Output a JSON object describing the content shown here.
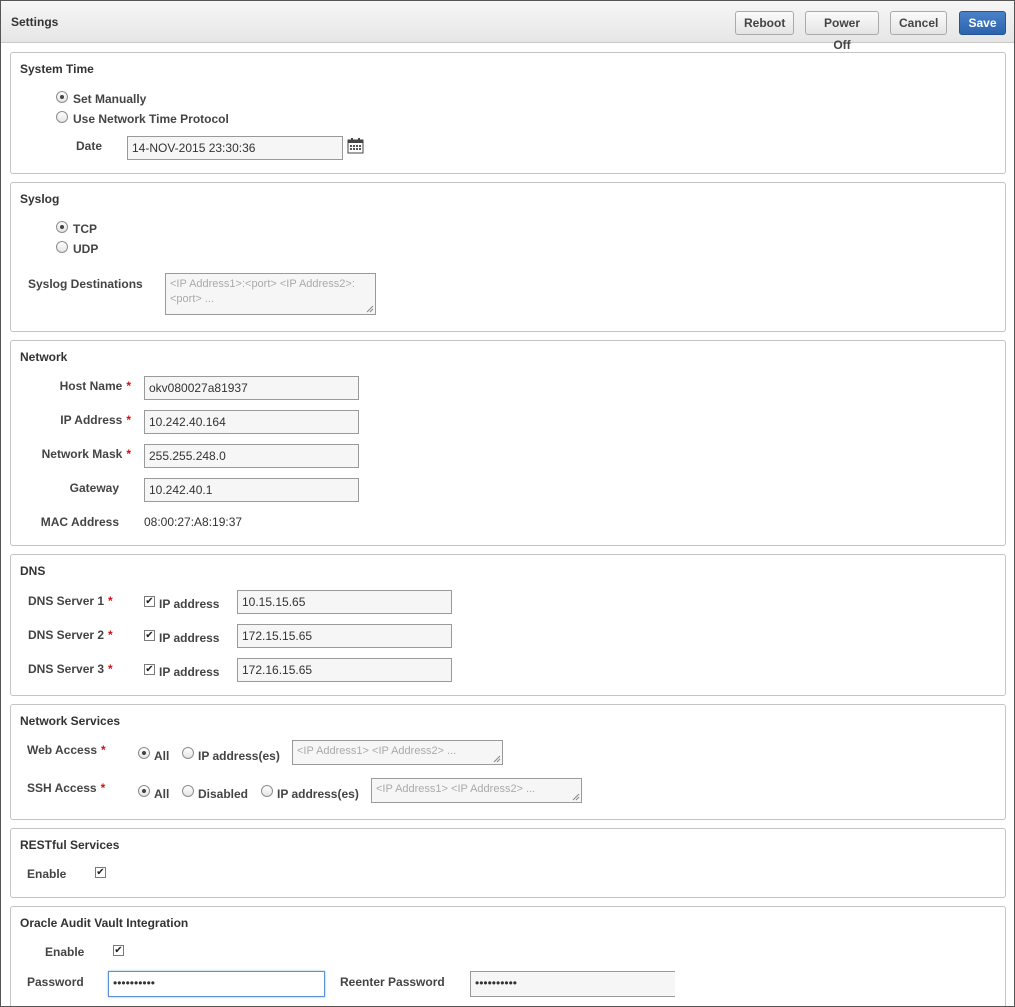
{
  "header": {
    "title": "Settings",
    "buttons": {
      "reboot": "Reboot",
      "power_off": "Power Off",
      "cancel": "Cancel",
      "save": "Save"
    }
  },
  "system_time": {
    "title": "System Time",
    "options": {
      "manual": "Set Manually",
      "ntp": "Use Network Time Protocol"
    },
    "selected": "manual",
    "date_label": "Date",
    "date_value": "14-NOV-2015 23:30:36",
    "calendar_icon": "calendar-icon"
  },
  "syslog": {
    "title": "Syslog",
    "options": {
      "tcp": "TCP",
      "udp": "UDP"
    },
    "selected": "tcp",
    "destinations_label": "Syslog Destinations",
    "destinations_placeholder": "<IP Address1>:<port> <IP Address2>:<port> ..."
  },
  "network": {
    "title": "Network",
    "required_mark": "*",
    "host_name_label": "Host Name",
    "host_name": "okv080027a81937",
    "ip_label": "IP Address",
    "ip": "10.242.40.164",
    "mask_label": "Network Mask",
    "mask": "255.255.248.0",
    "gateway_label": "Gateway",
    "gateway": "10.242.40.1",
    "mac_label": "MAC Address",
    "mac": "08:00:27:A8:19:37"
  },
  "dns": {
    "title": "DNS",
    "servers": [
      {
        "label": "DNS Server 1",
        "check_label": "IP address",
        "checked": true,
        "value": "10.15.15.65"
      },
      {
        "label": "DNS Server 2",
        "check_label": "IP address",
        "checked": true,
        "value": "172.15.15.65"
      },
      {
        "label": "DNS Server 3",
        "check_label": "IP address",
        "checked": true,
        "value": "172.16.15.65"
      }
    ]
  },
  "network_services": {
    "title": "Network Services",
    "web_access_label": "Web Access",
    "web_options": {
      "all": "All",
      "ips": "IP address(es)"
    },
    "web_selected": "all",
    "web_placeholder": "<IP Address1> <IP Address2> ...",
    "ssh_access_label": "SSH Access",
    "ssh_options": {
      "all": "All",
      "disabled": "Disabled",
      "ips": "IP address(es)"
    },
    "ssh_selected": "all",
    "ssh_placeholder": "<IP Address1> <IP Address2> ..."
  },
  "restful": {
    "title": "RESTful Services",
    "enable_label": "Enable",
    "enabled": true
  },
  "audit_vault": {
    "title": "Oracle Audit Vault Integration",
    "enable_label": "Enable",
    "enabled": true,
    "password_label": "Password",
    "password_value": "••••••••••",
    "reenter_label": "Reenter Password",
    "reenter_value": "••••••••••"
  },
  "colors": {
    "primary_button": "#2b63ad",
    "required": "#d01010",
    "focus_border": "#5b8fd6"
  }
}
